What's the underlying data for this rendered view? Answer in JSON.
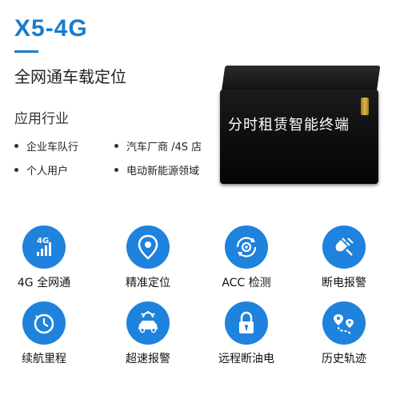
{
  "header": {
    "title": "X5-4G",
    "subtitle": "全网通车载定位"
  },
  "industry": {
    "heading": "应用行业",
    "items": [
      "企业车队行",
      "汽车厂商 /4S 店",
      "个人用户",
      "电动新能源领域"
    ]
  },
  "device": {
    "label": "分时租赁智能终端"
  },
  "features": [
    {
      "label": "4G 全网通",
      "icon": "4g-signal-icon",
      "icon_text": "4G"
    },
    {
      "label": "精准定位",
      "icon": "location-pin-icon"
    },
    {
      "label": "ACC 检测",
      "icon": "gear-refresh-icon"
    },
    {
      "label": "断电报警",
      "icon": "power-plug-icon"
    },
    {
      "label": "续航里程",
      "icon": "stopwatch-icon"
    },
    {
      "label": "超速报警",
      "icon": "speeding-car-icon"
    },
    {
      "label": "远程断油电",
      "icon": "lock-icon"
    },
    {
      "label": "历史轨迹",
      "icon": "route-icon"
    }
  ],
  "colors": {
    "accent": "#1a7ccc",
    "icon_bg": "#1f82dc"
  }
}
